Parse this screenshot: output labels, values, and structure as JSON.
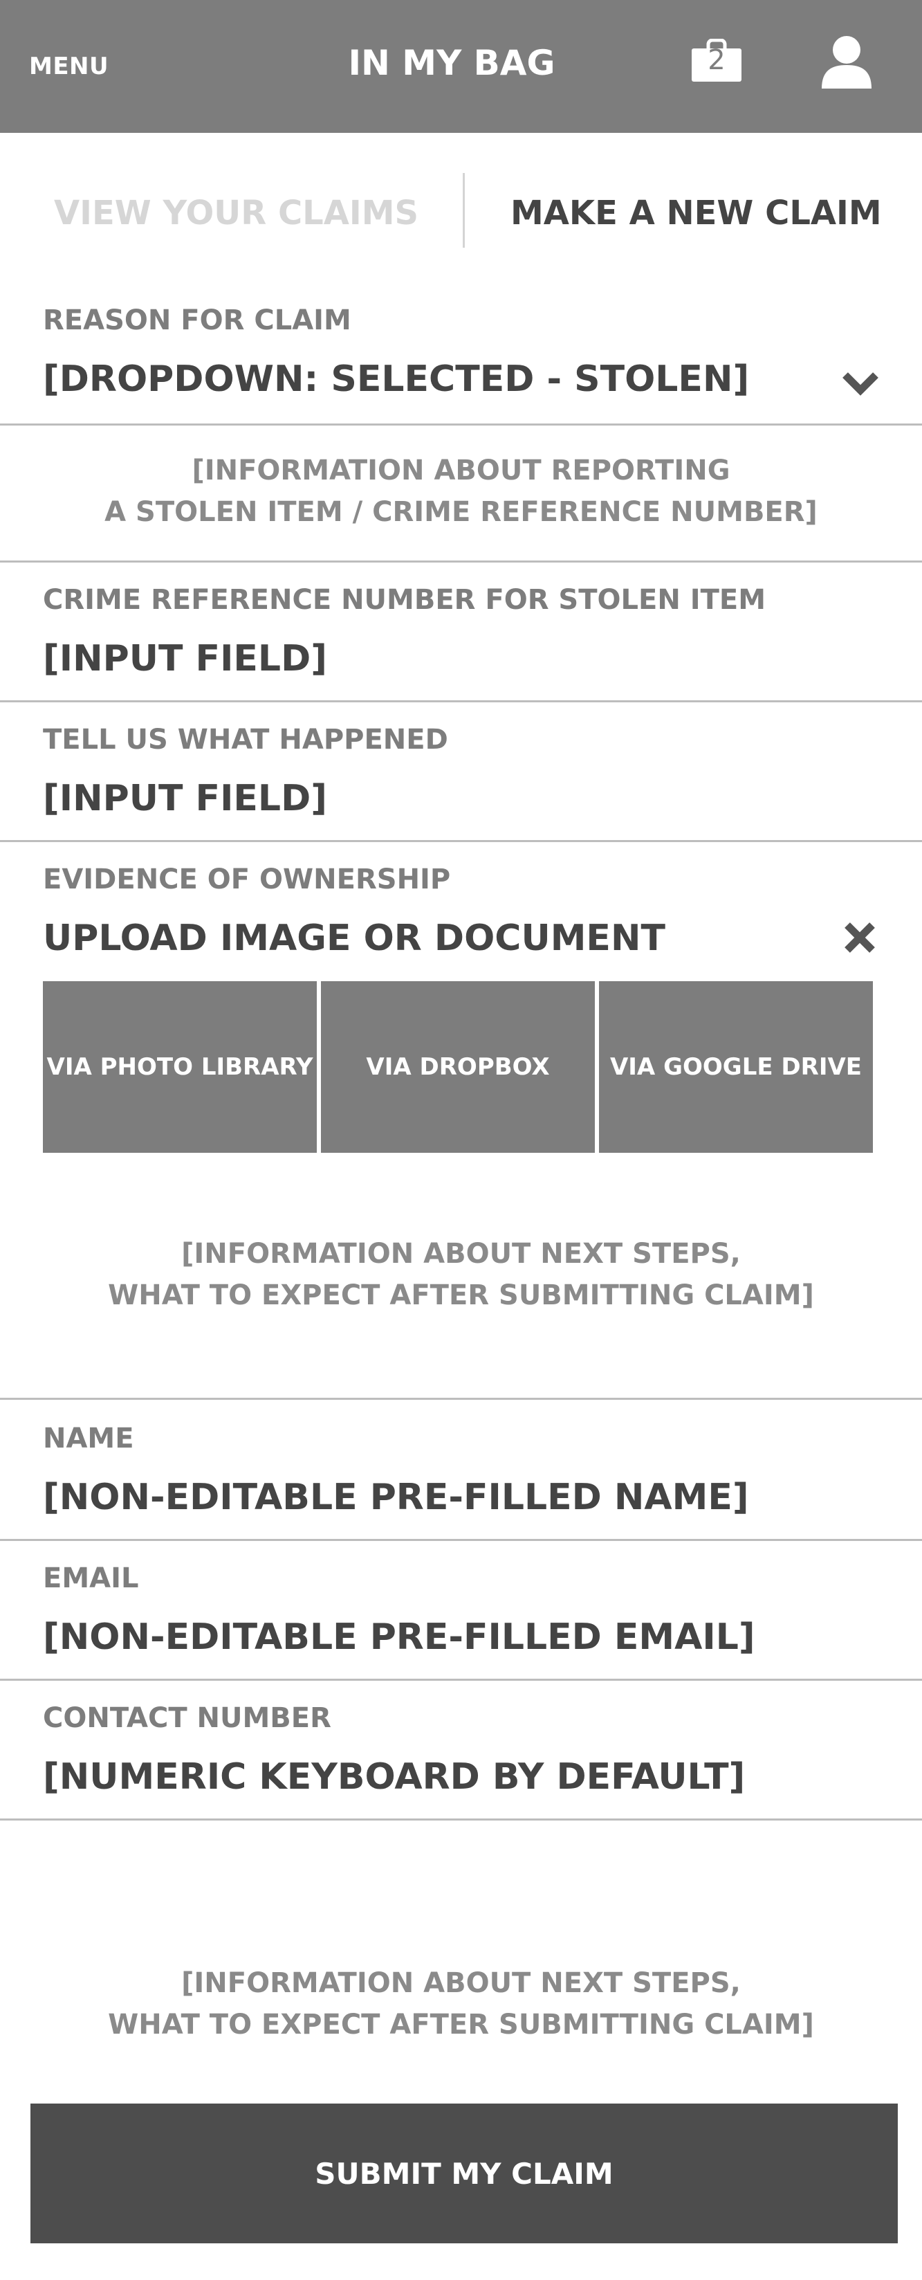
{
  "header": {
    "menu_label": "MENU",
    "title": "IN MY BAG",
    "bag_count": "2",
    "bag_icon": "shopping-bag-icon",
    "user_icon": "user-icon",
    "background_color": "#7d7d7d"
  },
  "tabs": [
    {
      "label": "VIEW YOUR CLAIMS",
      "active": false
    },
    {
      "label": "MAKE A NEW CLAIM",
      "active": true
    }
  ],
  "form": {
    "reason": {
      "label": "REASON FOR CLAIM",
      "value": "[DROPDOWN: SELECTED - STOLEN]",
      "icon": "chevron-down-icon"
    },
    "reporting_info": {
      "line1": "[INFORMATION ABOUT REPORTING",
      "line2": "A STOLEN ITEM / CRIME REFERENCE NUMBER]"
    },
    "crime_reference": {
      "label": "CRIME REFERENCE NUMBER FOR STOLEN ITEM",
      "value": "[INPUT FIELD]"
    },
    "what_happened": {
      "label": "TELL US WHAT HAPPENED",
      "value": "[INPUT FIELD]"
    },
    "evidence": {
      "label": "EVIDENCE OF OWNERSHIP",
      "value": "UPLOAD IMAGE OR DOCUMENT",
      "close_icon": "close-icon",
      "options": [
        "VIA PHOTO LIBRARY",
        "VIA DROPBOX",
        "VIA GOOGLE DRIVE"
      ]
    },
    "next_steps_info_1": {
      "line1": "[INFORMATION ABOUT NEXT STEPS,",
      "line2": "WHAT TO EXPECT AFTER SUBMITTING CLAIM]"
    },
    "name": {
      "label": "NAME",
      "value": "[NON-EDITABLE PRE-FILLED NAME]"
    },
    "email": {
      "label": "EMAIL",
      "value": "[NON-EDITABLE PRE-FILLED EMAIL]"
    },
    "contact": {
      "label": "CONTACT NUMBER",
      "value": "[NUMERIC KEYBOARD BY DEFAULT]"
    },
    "next_steps_info_2": {
      "line1": "[INFORMATION ABOUT NEXT STEPS,",
      "line2": "WHAT TO EXPECT AFTER SUBMITTING CLAIM]"
    },
    "submit_label": "SUBMIT MY CLAIM",
    "submit_color": "#4d4d4d"
  }
}
